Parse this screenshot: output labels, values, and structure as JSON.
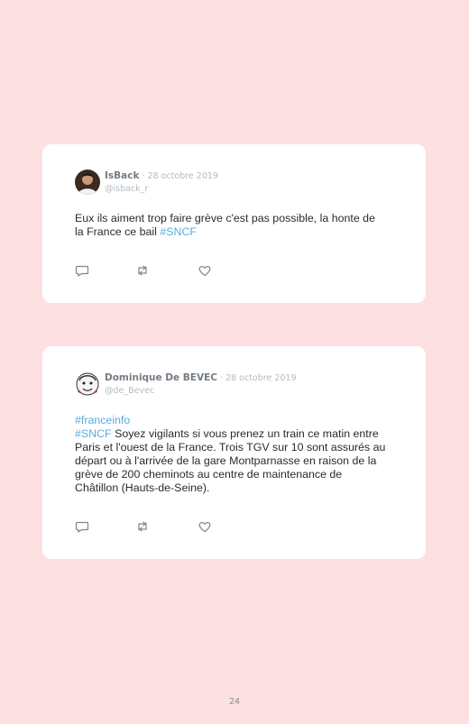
{
  "page": {
    "background_color": "#fde0e1",
    "page_number": "24"
  },
  "colors": {
    "hashtag": "#5aabdc",
    "author": "#737c84",
    "meta": "#b4bcc2",
    "body_text": "#2b2b2b"
  },
  "tweets": [
    {
      "author": "IsBack",
      "separator": " · ",
      "date": "28 octobre 2019",
      "handle": "@isback_r",
      "avatar_icon": "user-photo-avatar",
      "text_before": "Eux ils aiment trop faire grève c'est pas possible, la honte de la France ce bail ",
      "hashtag": "#SNCF",
      "actions": [
        "reply-icon",
        "retweet-icon",
        "like-icon"
      ]
    },
    {
      "author": "Dominique De BEVEC",
      "separator": " · ",
      "date": "28 octobre 2019",
      "handle": "@de_Bevec",
      "avatar_icon": "cartoon-avatar",
      "hashtag_1": "#franceinfo",
      "hashtag_2": "#SNCF",
      "text_after": " Soyez vigilants si vous prenez un train ce matin entre Paris et l'ouest de la France. Trois TGV sur 10 sont assurés au départ ou à l'arrivée de la gare Montparnasse en raison de la grève de 200 cheminots au centre de maintenance de Châtillon (Hauts-de-Seine).",
      "actions": [
        "reply-icon",
        "retweet-icon",
        "like-icon"
      ]
    }
  ]
}
